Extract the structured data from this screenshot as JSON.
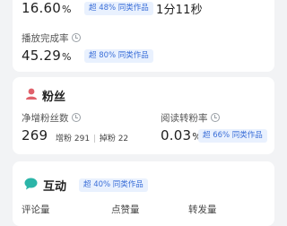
{
  "top_card": {
    "metric1_value": "16.60",
    "metric1_unit": "%",
    "metric1_badge": "超 48% 同类作品",
    "duration_value": "1分11秒",
    "completion_label": "播放完成率",
    "completion_value": "45.29",
    "completion_unit": "%",
    "completion_badge": "超 80% 同类作品"
  },
  "fans_card": {
    "title": "粉丝",
    "net_label": "净增粉丝数",
    "net_value": "269",
    "gain_text": "增粉 291",
    "loss_text": "掉粉 22",
    "convert_label": "阅读转粉率",
    "convert_value": "0.03",
    "convert_unit": "%",
    "convert_badge": "超 66% 同类作品"
  },
  "interact_card": {
    "title": "互动",
    "badge": "超 40% 同类作品",
    "columns": [
      "评论量",
      "点赞量",
      "转发量"
    ]
  },
  "colors": {
    "accent_blue": "#3b6fd8",
    "badge_bg": "#e9f1fe",
    "user_icon": "#e0616b",
    "chat_icon": "#2bb5a8"
  }
}
